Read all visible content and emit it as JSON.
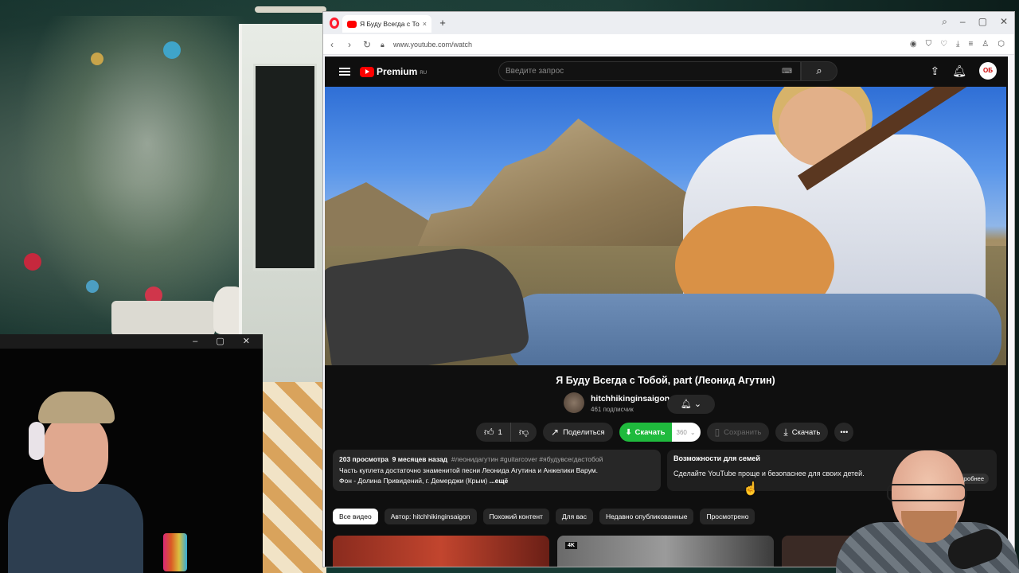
{
  "browser": {
    "tab_title": "Я Буду Всегда с Тобой, p",
    "tab_close": "×",
    "new_tab": "+",
    "url": "www.youtube.com/watch"
  },
  "cam_left": {
    "controls": "–  ▢  ✕"
  },
  "youtube": {
    "brand": "Premium",
    "country": "RU",
    "search_placeholder": "Введите запрос",
    "avatar_initials": "ОБ",
    "video": {
      "title": "Я Буду Всегда с Тобой, part (Леонид Агутин)",
      "channel_name": "hitchhikinginsaigon",
      "subscribers": "461 подписчик"
    },
    "actions": {
      "like_count": "1",
      "share": "Поделиться",
      "download_green": "Скачать",
      "quality": "360",
      "save": "Сохранить",
      "download": "Скачать"
    },
    "description": {
      "views": "203 просмотра",
      "date": "9 месяцев назад",
      "tags": "#леонидагутин #guitarcover #ябудувсегдастобой",
      "line1": "Часть куплета достаточно знаменитой песни Леонида Агутина и Анжелики Варум.",
      "line2": "Фон - Долина Привидений, г. Демерджи (Крым)",
      "more": "...ещё"
    },
    "family": {
      "heading": "Возможности для семей",
      "text": "Сделайте YouTube проще и безопаснее для своих детей.",
      "more": "Подробнее"
    },
    "chips": [
      "Все видео",
      "Автор: hitchhikinginsaigon",
      "Похожий контент",
      "Для вас",
      "Недавно опубликованные",
      "Просмотрено"
    ],
    "thumb_badge": "4K"
  }
}
